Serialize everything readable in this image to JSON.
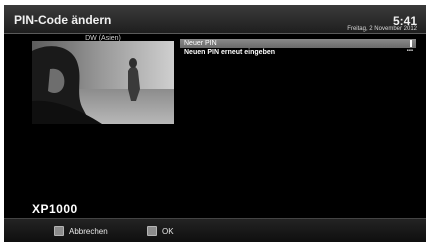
{
  "header": {
    "title": "PIN-Code ändern",
    "time": "5:41",
    "date": "Freitag, 2 November 2012"
  },
  "preview": {
    "channel": "DW (Asien)"
  },
  "pin_fields": [
    {
      "label": "Neuer PIN"
    },
    {
      "label": "Neuen PIN erneut eingeben"
    }
  ],
  "model": "XP1000",
  "buttons": {
    "cancel_label": "Abbrechen",
    "ok_label": "OK"
  }
}
